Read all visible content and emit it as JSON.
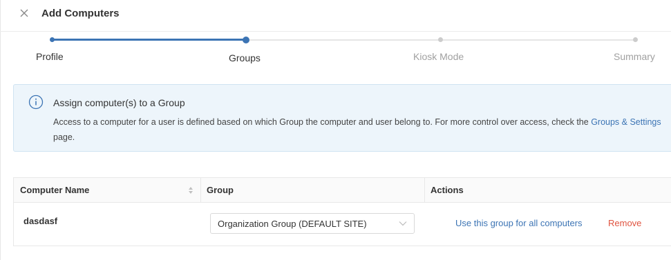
{
  "header": {
    "title": "Add Computers",
    "close_icon": "close-icon"
  },
  "stepper": {
    "progress": 0.333,
    "steps": [
      {
        "label": "Profile",
        "state": "done"
      },
      {
        "label": "Groups",
        "state": "current"
      },
      {
        "label": "Kiosk Mode",
        "state": "todo"
      },
      {
        "label": "Summary",
        "state": "todo"
      }
    ]
  },
  "info": {
    "icon": "info-icon",
    "title": "Assign computer(s) to a Group",
    "body_prefix": "Access to a computer for a user is defined based on which Group the computer and user belong to. For more control over access, check the ",
    "link_text": "Groups & Settings",
    "body_suffix": " page."
  },
  "table": {
    "columns": [
      "Computer Name",
      "Group",
      "Actions"
    ],
    "rows": [
      {
        "name": "dasdasf",
        "group": "Organization Group (DEFAULT SITE)",
        "use_all_label": "Use this group for all computers",
        "remove_label": "Remove"
      }
    ]
  },
  "colors": {
    "accent": "#3c74b4",
    "danger": "#e0533f",
    "banner_bg": "#edf5fb"
  }
}
